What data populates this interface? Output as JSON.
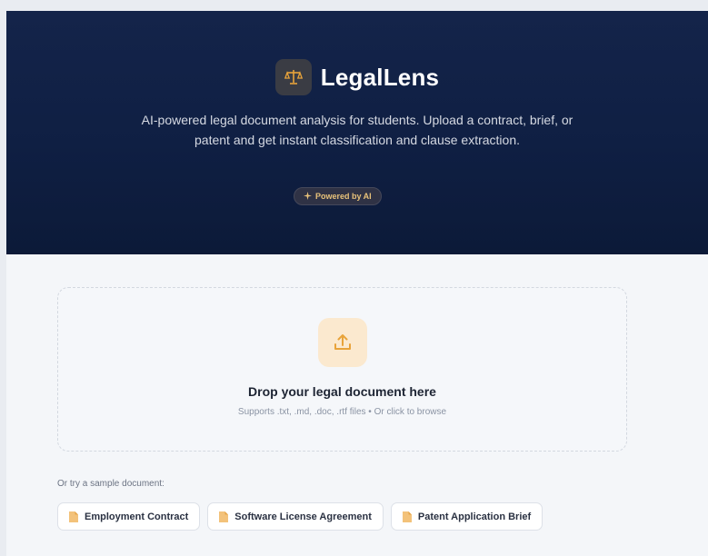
{
  "app": {
    "title": "LegalLens",
    "tagline": "AI-powered legal document analysis for students. Upload a contract, brief, or patent and get instant classification and clause extraction.",
    "badge": "Powered by AI"
  },
  "upload": {
    "title": "Drop your legal document here",
    "subtitle": "Supports .txt, .md, .doc, .rtf files • Or click to browse"
  },
  "samples": {
    "label": "Or try a sample document:",
    "items": [
      {
        "label": "Employment Contract"
      },
      {
        "label": "Software License Agreement"
      },
      {
        "label": "Patent Application Brief"
      }
    ]
  },
  "colors": {
    "hero": "#0f1f43",
    "accent": "#e8a33a",
    "background": "#f4f6f9"
  },
  "icons": {
    "logo": "scales-icon",
    "badge": "sparkle-icon",
    "upload": "upload-icon",
    "sample": "document-icon"
  }
}
